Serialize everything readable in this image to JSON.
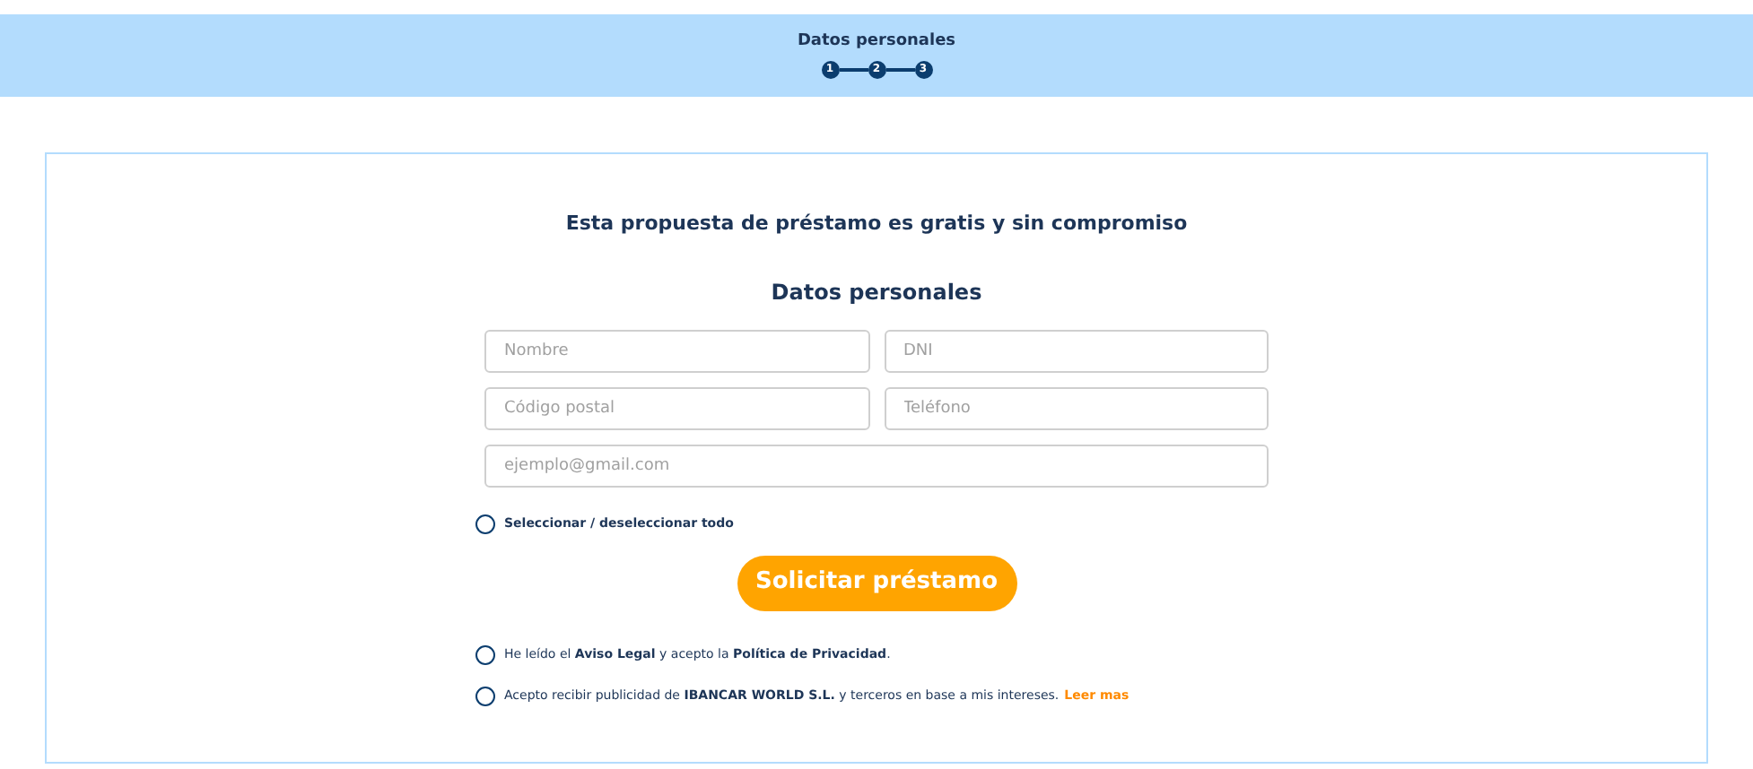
{
  "header": {
    "title": "Datos personales",
    "steps": [
      {
        "label": "1"
      },
      {
        "label": "2"
      },
      {
        "label": "3"
      }
    ]
  },
  "form": {
    "intro": "Esta propuesta de préstamo es gratis y sin compromiso",
    "heading": "Datos personales",
    "fields": [
      {
        "kind": "half",
        "placeholder": "Nombre"
      },
      {
        "kind": "half",
        "placeholder": "DNI"
      },
      {
        "kind": "half",
        "placeholder": "Código postal"
      },
      {
        "kind": "half",
        "placeholder": "Teléfono"
      },
      {
        "kind": "full",
        "placeholder": "ejemplo@gmail.com"
      }
    ],
    "select_all": {
      "label": "Seleccionar / deseleccionar todo",
      "checked": false
    },
    "submit": "Solicitar préstamo",
    "consents": [
      {
        "text": "He leído el **Aviso Legal** y acepto la **Política de Privacidad**.",
        "checked": false
      },
      {
        "text": "Acepto recibir publicidad de **IBANCAR WORLD S.L.** y terceros en base a mis intereses.",
        "link": "Leer mas",
        "checked": false
      }
    ]
  }
}
